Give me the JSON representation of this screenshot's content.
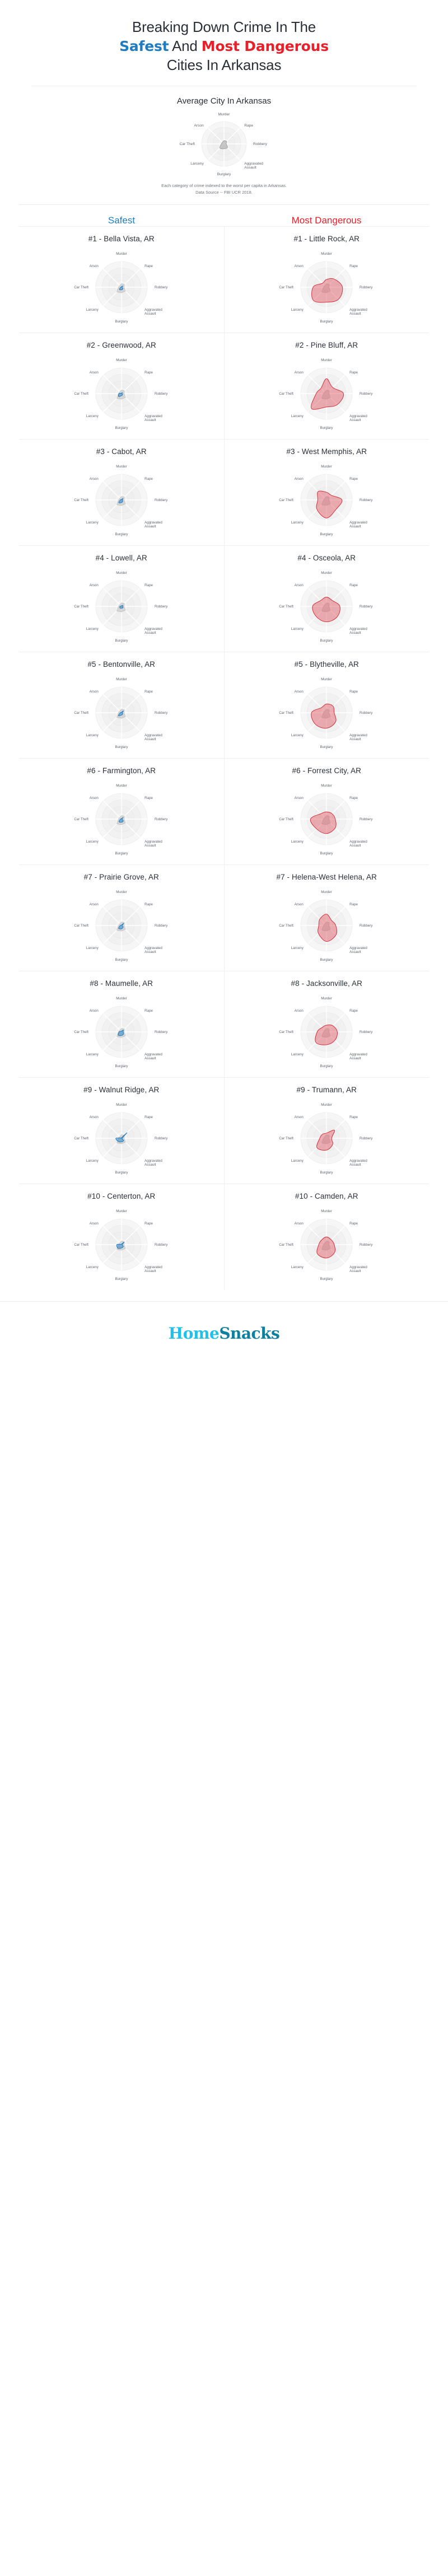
{
  "title": {
    "line1": "Breaking Down Crime In The",
    "line2_pre": "",
    "line2_safest": "Safest",
    "line2_mid": " And ",
    "line2_dangerous": "Most Dangerous",
    "line3": "Cities In Arkansas"
  },
  "colors": {
    "safest": "#1f7cc0",
    "dangerous": "#e8202a",
    "safest_fill": "#2e86c8",
    "dangerous_fill": "#e05560",
    "average_fill": "#9a9a9a",
    "grid": "#e2e2e2",
    "logo_light": "#22c0e8",
    "logo_dark": "#0f7fa0"
  },
  "average": {
    "heading": "Average City In Arkansas",
    "footnote_line1": "Each category of crime indexed to the worst per capita in Arkansas.",
    "footnote_line2": "Data Source -- FBI UCR 2018."
  },
  "columns": {
    "safest_label": "Safest",
    "dangerous_label": "Most Dangerous"
  },
  "axes": [
    "Murder",
    "Rape",
    "Robbery",
    "Aggravated Assault",
    "Burglary",
    "Larceny",
    "Car Theft",
    "Arson"
  ],
  "axis_labels_display": [
    "Murder",
    "Rape",
    "Robbery",
    "Aggravated",
    "Assault",
    "Burglary",
    "Larceny",
    "Car Theft",
    "Arson"
  ],
  "footer": {
    "logo_part1": "Home",
    "logo_part2": "Snacks"
  },
  "chart_data": {
    "type": "radar",
    "axes": [
      "Murder",
      "Rape",
      "Robbery",
      "Aggravated Assault",
      "Burglary",
      "Larceny",
      "Car Theft",
      "Arson"
    ],
    "rmax": 1.0,
    "grid_rings": [
      0.25,
      0.5,
      0.75,
      1.0
    ],
    "note": "Each category of crime indexed to the worst per capita in Arkansas. Data Source -- FBI UCR 2018.",
    "average": {
      "name": "Average City In Arkansas",
      "values": [
        0.14,
        0.16,
        0.1,
        0.22,
        0.22,
        0.26,
        0.12,
        0.1
      ]
    },
    "safest": [
      {
        "rank": "#1",
        "name": "#1 - Bella Vista, AR",
        "values": [
          0.02,
          0.07,
          0.02,
          0.08,
          0.1,
          0.12,
          0.03,
          0.02
        ]
      },
      {
        "rank": "#2",
        "name": "#2 - Greenwood, AR",
        "values": [
          0.02,
          0.05,
          0.02,
          0.06,
          0.08,
          0.16,
          0.1,
          0.02
        ]
      },
      {
        "rank": "#3",
        "name": "#3 - Cabot, AR",
        "values": [
          0.02,
          0.08,
          0.03,
          0.07,
          0.1,
          0.15,
          0.05,
          0.02
        ]
      },
      {
        "rank": "#4",
        "name": "#4 - Lowell, AR",
        "values": [
          0.02,
          0.06,
          0.05,
          0.08,
          0.07,
          0.09,
          0.06,
          0.02
        ]
      },
      {
        "rank": "#5",
        "name": "#5 - Bentonville, AR",
        "values": [
          0.02,
          0.1,
          0.03,
          0.07,
          0.09,
          0.17,
          0.05,
          0.02
        ]
      },
      {
        "rank": "#6",
        "name": "#6 - Farmington, AR",
        "values": [
          0.02,
          0.09,
          0.02,
          0.1,
          0.12,
          0.14,
          0.04,
          0.02
        ]
      },
      {
        "rank": "#7",
        "name": "#7 - Prairie Grove, AR",
        "values": [
          0.02,
          0.12,
          0.03,
          0.09,
          0.13,
          0.16,
          0.05,
          0.02
        ]
      },
      {
        "rank": "#8",
        "name": "#8 - Maumelle, AR",
        "values": [
          0.03,
          0.1,
          0.06,
          0.11,
          0.14,
          0.18,
          0.09,
          0.03
        ]
      },
      {
        "rank": "#9",
        "name": "#9 - Walnut Ridge, AR",
        "values": [
          0.02,
          0.3,
          0.03,
          0.12,
          0.14,
          0.18,
          0.22,
          0.02
        ]
      },
      {
        "rank": "#10",
        "name": "#10 - Centerton, AR",
        "values": [
          0.02,
          0.14,
          0.03,
          0.1,
          0.13,
          0.2,
          0.18,
          0.02
        ]
      }
    ],
    "dangerous": [
      {
        "rank": "#1",
        "name": "#1 - Little Rock, AR",
        "values": [
          0.3,
          0.44,
          0.62,
          0.66,
          0.58,
          0.72,
          0.52,
          0.22
        ]
      },
      {
        "rank": "#2",
        "name": "#2 - Pine Bluff, AR",
        "values": [
          0.58,
          0.34,
          0.66,
          0.6,
          0.52,
          0.82,
          0.4,
          0.3
        ]
      },
      {
        "rank": "#3",
        "name": "#3 - West Memphis, AR",
        "values": [
          0.3,
          0.26,
          0.6,
          0.52,
          0.7,
          0.52,
          0.34,
          0.46
        ]
      },
      {
        "rank": "#4",
        "name": "#4 - Osceola, AR",
        "values": [
          0.36,
          0.32,
          0.52,
          0.58,
          0.6,
          0.56,
          0.54,
          0.32
        ]
      },
      {
        "rank": "#5",
        "name": "#5 - Blytheville, AR",
        "values": [
          0.34,
          0.36,
          0.3,
          0.5,
          0.6,
          0.62,
          0.58,
          0.28
        ]
      },
      {
        "rank": "#6",
        "name": "#6 - Forrest City, AR",
        "values": [
          0.28,
          0.3,
          0.34,
          0.48,
          0.56,
          0.54,
          0.62,
          0.3
        ]
      },
      {
        "rank": "#7",
        "name": "#7 - Helena-West Helena, AR",
        "values": [
          0.44,
          0.28,
          0.36,
          0.52,
          0.62,
          0.44,
          0.3,
          0.36
        ]
      },
      {
        "rank": "#8",
        "name": "#8 - Jacksonville, AR",
        "values": [
          0.26,
          0.34,
          0.42,
          0.46,
          0.5,
          0.58,
          0.36,
          0.24
        ]
      },
      {
        "rank": "#9",
        "name": "#9 - Trumann, AR",
        "values": [
          0.2,
          0.44,
          0.2,
          0.34,
          0.46,
          0.52,
          0.26,
          0.22
        ]
      },
      {
        "rank": "#10",
        "name": "#10 - Camden, AR",
        "values": [
          0.3,
          0.26,
          0.3,
          0.44,
          0.52,
          0.5,
          0.3,
          0.26
        ]
      }
    ]
  }
}
